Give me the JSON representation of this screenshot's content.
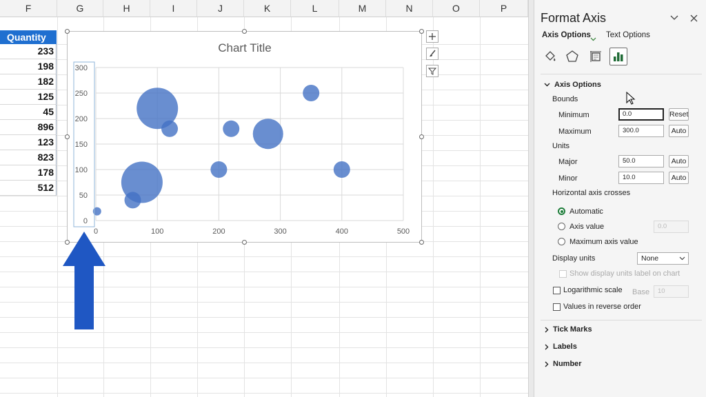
{
  "spreadsheet": {
    "columns": [
      "F",
      "G",
      "H",
      "I",
      "J",
      "K",
      "L",
      "M",
      "N",
      "O",
      "P"
    ],
    "quantity_header": "Quantity",
    "quantities": [
      "233",
      "198",
      "182",
      "125",
      "45",
      "896",
      "123",
      "823",
      "178",
      "512"
    ]
  },
  "chart": {
    "selected_axis": "vertical"
  },
  "chart_data": {
    "type": "scatter",
    "title": "Chart Title",
    "xlim": [
      0,
      500
    ],
    "ylim": [
      0,
      300
    ],
    "x_ticks": [
      "0",
      "100",
      "200",
      "300",
      "400",
      "500"
    ],
    "y_ticks": [
      "0",
      "50",
      "100",
      "150",
      "200",
      "250",
      "300"
    ],
    "grid": true,
    "bubble_color": "#4472c4",
    "points": [
      {
        "x": 2,
        "y": 18,
        "size": "tiny"
      },
      {
        "x": 60,
        "y": 40,
        "size": "small"
      },
      {
        "x": 75,
        "y": 75,
        "size": "large"
      },
      {
        "x": 100,
        "y": 220,
        "size": "large"
      },
      {
        "x": 120,
        "y": 180,
        "size": "small"
      },
      {
        "x": 200,
        "y": 100,
        "size": "small"
      },
      {
        "x": 220,
        "y": 180,
        "size": "small"
      },
      {
        "x": 280,
        "y": 170,
        "size": "medium"
      },
      {
        "x": 350,
        "y": 250,
        "size": "small"
      },
      {
        "x": 400,
        "y": 100,
        "size": "small"
      }
    ]
  },
  "chart_tools": [
    "add-chart-element-icon",
    "chart-styles-icon",
    "chart-filters-icon"
  ],
  "annotation": {
    "arrow_color": "#1f57c3"
  },
  "format_pane": {
    "title": "Format Axis",
    "tabs": {
      "axis_options": "Axis Options",
      "text_options": "Text Options"
    },
    "icons": [
      "fill-line-icon",
      "effects-icon",
      "size-properties-icon",
      "axis-options-icon"
    ],
    "section_axis_options": "Axis Options",
    "bounds_label": "Bounds",
    "minimum_label": "Minimum",
    "minimum_value": "0.0",
    "minimum_button": "Reset",
    "maximum_label": "Maximum",
    "maximum_value": "300.0",
    "maximum_button": "Auto",
    "units_label": "Units",
    "major_label": "Major",
    "major_value": "50.0",
    "major_button": "Auto",
    "minor_label": "Minor",
    "minor_value": "10.0",
    "minor_button": "Auto",
    "crosses_label": "Horizontal axis crosses",
    "crosses_automatic": "Automatic",
    "crosses_axis_value": "Axis value",
    "crosses_axis_value_input": "0.0",
    "crosses_maximum": "Maximum axis value",
    "display_units_label": "Display units",
    "display_units_value": "None",
    "show_units_label": "Show display units label on chart",
    "log_scale_label": "Logarithmic scale",
    "base_label": "Base",
    "base_value": "10",
    "reverse_label": "Values in reverse order",
    "tick_marks": "Tick Marks",
    "labels": "Labels",
    "number": "Number"
  }
}
